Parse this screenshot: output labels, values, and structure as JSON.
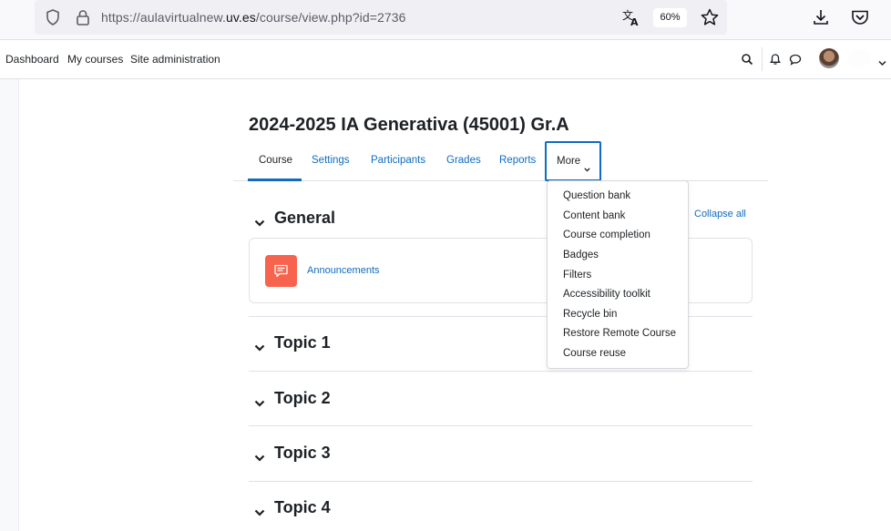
{
  "browser": {
    "url_prefix": "https://aulavirtualnew.",
    "url_domain": "uv.es",
    "url_suffix": "/course/view.php?id=2736",
    "zoom": "60%"
  },
  "navbar": {
    "links": [
      "Dashboard",
      "My courses",
      "Site administration"
    ]
  },
  "course": {
    "title": "2024-2025 IA Generativa (45001) Gr.A",
    "tabs": [
      "Course",
      "Settings",
      "Participants",
      "Grades",
      "Reports"
    ],
    "more_label": "More",
    "more_menu": [
      "Question bank",
      "Content bank",
      "Course completion",
      "Badges",
      "Filters",
      "Accessibility toolkit",
      "Recycle bin",
      "Restore Remote Course",
      "Course reuse"
    ],
    "collapse_all": "Collapse all",
    "sections": [
      "General",
      "Topic 1",
      "Topic 2",
      "Topic 3",
      "Topic 4"
    ],
    "activity": "Announcements"
  },
  "colors": {
    "link": "#0f6cbf",
    "forum_icon_bg": "#f7634d",
    "text": "#1d2125"
  },
  "icons": [
    "shield-icon",
    "lock-icon",
    "translate-icon",
    "star-icon",
    "download-icon",
    "pocket-icon",
    "search-icon",
    "bell-icon",
    "chat-icon",
    "chevron-down-icon",
    "forum-icon"
  ]
}
